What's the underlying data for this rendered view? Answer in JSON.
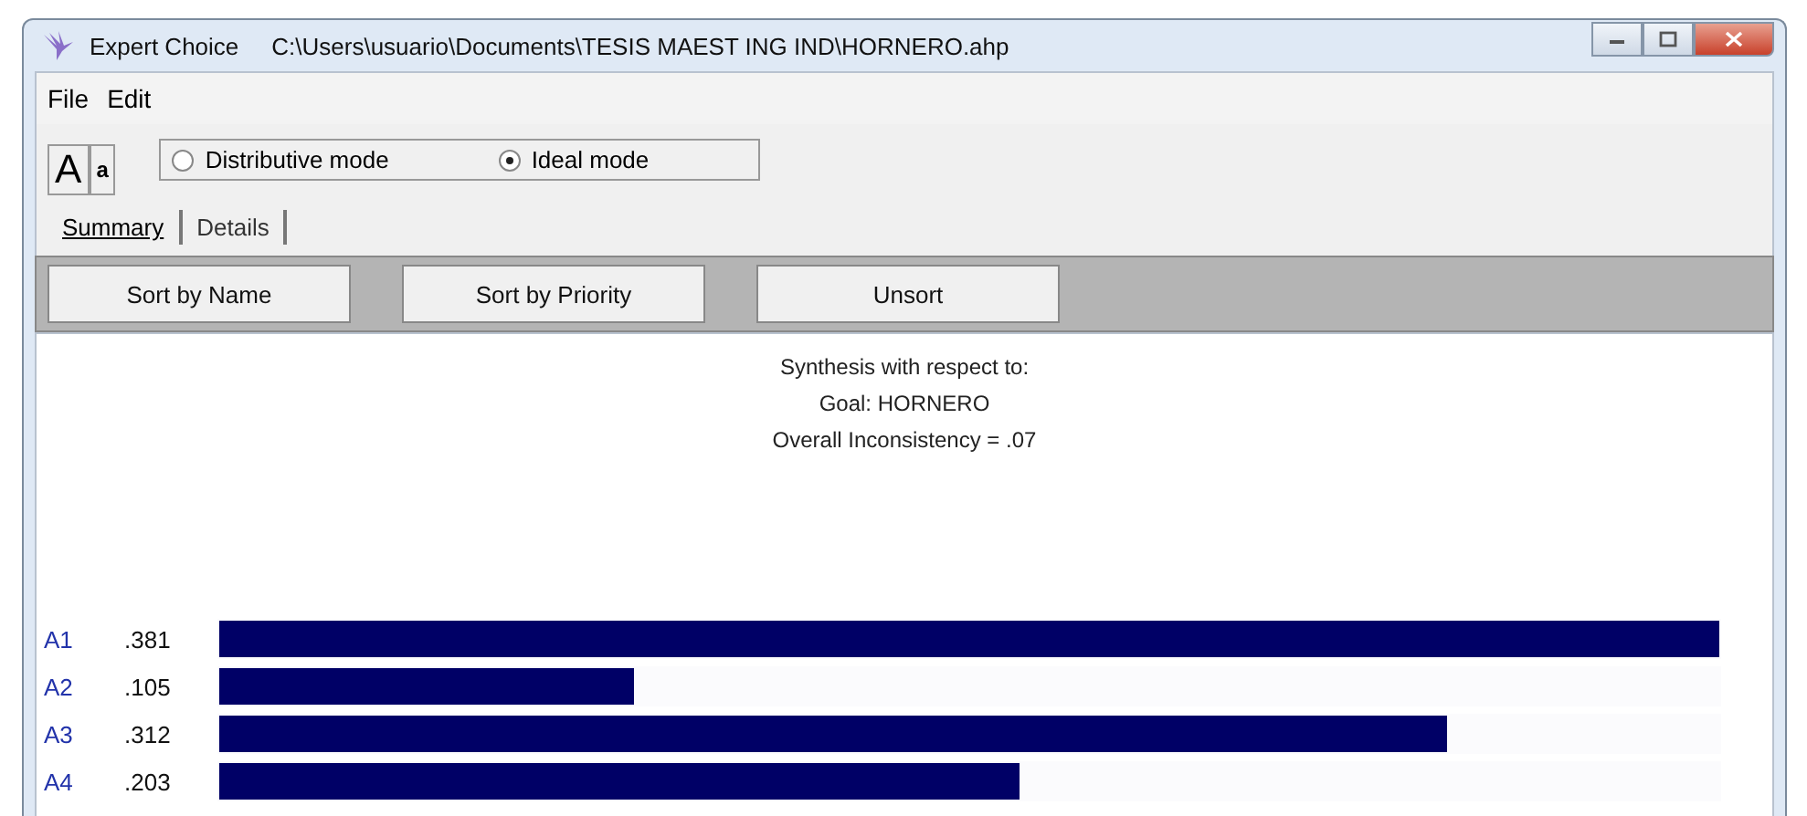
{
  "window": {
    "app": "Expert Choice",
    "title": "C:\\Users\\usuario\\Documents\\TESIS MAEST ING IND\\HORNERO.ahp"
  },
  "menu": [
    "File",
    "Edit"
  ],
  "font_buttons": [
    "A",
    "a"
  ],
  "modes": [
    {
      "label": "Distributive mode",
      "selected": false
    },
    {
      "label": "Ideal mode",
      "selected": true
    }
  ],
  "tabs": [
    {
      "label": "Summary",
      "selected": true
    },
    {
      "label": "Details",
      "selected": false
    }
  ],
  "sort_buttons": [
    "Sort by Name",
    "Sort by Priority",
    "Unsort"
  ],
  "synthesis": {
    "heading": "Synthesis with respect to:",
    "goal": "Goal: HORNERO",
    "inconsistency": "Overall Inconsistency = .07"
  },
  "alternatives": [
    {
      "name": "A1",
      "value": ".381",
      "level": 1.0
    },
    {
      "name": "A2",
      "value": ".105",
      "level": 0.276
    },
    {
      "name": "A3",
      "value": ".312",
      "level": 0.819
    },
    {
      "name": "A4",
      "value": ".203",
      "level": 0.533
    }
  ]
}
